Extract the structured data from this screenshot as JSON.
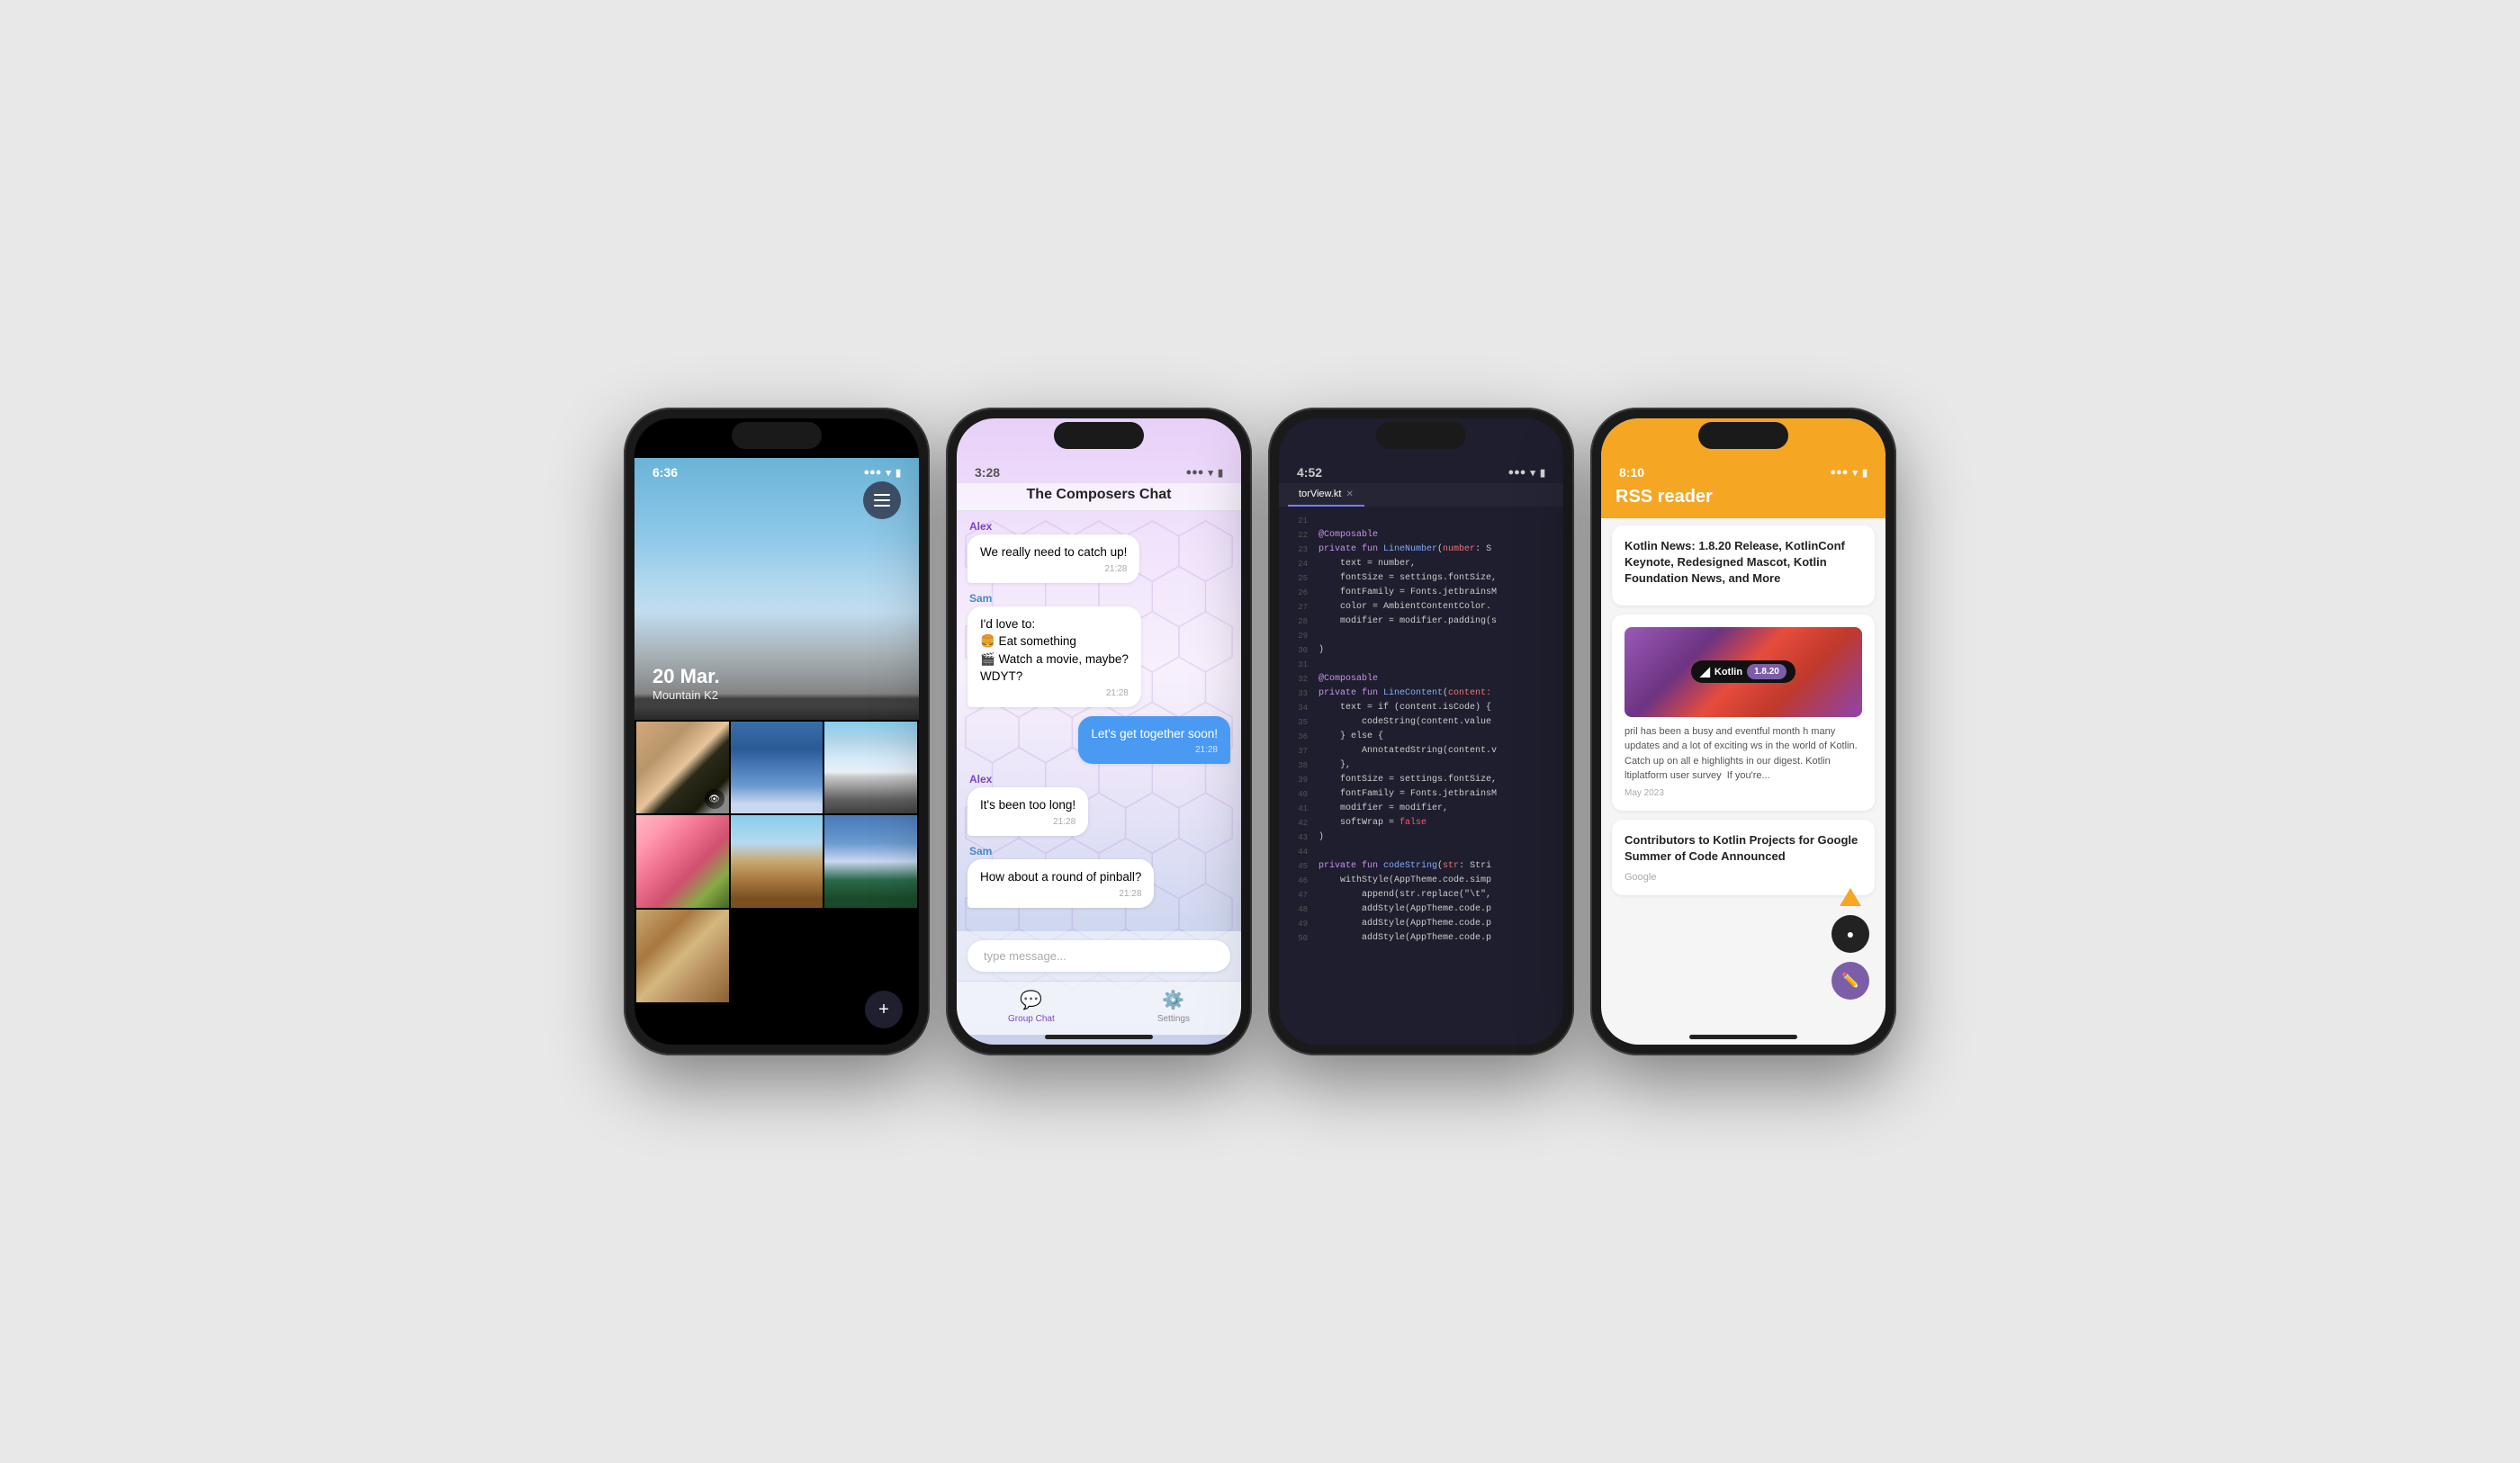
{
  "phones": [
    {
      "id": "gallery",
      "time": "6:36",
      "hero": {
        "date": "20 Mar.",
        "location": "Mountain K2"
      },
      "grid_images": [
        "cat",
        "blue-city",
        "mountain2",
        "cherry",
        "desert",
        "tower",
        "last"
      ],
      "add_btn_label": "+"
    },
    {
      "id": "chat",
      "time": "3:28",
      "title": "The Composers Chat",
      "messages": [
        {
          "sender": "Alex",
          "text": "We really need to catch up!",
          "time": "21:28",
          "type": "received",
          "sender_class": "alex"
        },
        {
          "sender": "Sam",
          "text": "I'd love to:\n🍔 Eat something\n🎬 Watch a movie, maybe?\nWDYT?",
          "time": "21:28",
          "type": "received",
          "sender_class": "sam"
        },
        {
          "sender": "",
          "text": "Let's get together soon!",
          "time": "21:28",
          "type": "sent",
          "sender_class": ""
        },
        {
          "sender": "Alex",
          "text": "It's been too long!",
          "time": "21:28",
          "type": "received",
          "sender_class": "alex"
        },
        {
          "sender": "Sam",
          "text": "How about a round of pinball?",
          "time": "21:28",
          "type": "received",
          "sender_class": "sam"
        }
      ],
      "input_placeholder": "type message...",
      "tabs": [
        {
          "label": "Group Chat",
          "icon": "💬",
          "active": true
        },
        {
          "label": "Settings",
          "icon": "⚙️",
          "active": false
        }
      ]
    },
    {
      "id": "code",
      "time": "4:52",
      "tab_name": "torView.kt",
      "lines": [
        {
          "num": "21",
          "code": ""
        },
        {
          "num": "22",
          "tokens": [
            [
              "kw",
              "@Composable"
            ]
          ]
        },
        {
          "num": "23",
          "tokens": [
            [
              "kw",
              "private fun "
            ],
            [
              "fn",
              "LineNumber"
            ],
            [
              "",
              "("
            ],
            [
              "param",
              "number"
            ],
            [
              "",
              ": S"
            ]
          ]
        },
        {
          "num": "24",
          "tokens": [
            [
              "",
              "    text = number,"
            ]
          ]
        },
        {
          "num": "25",
          "tokens": [
            [
              "",
              "    fontSize = settings.fontSize,"
            ]
          ]
        },
        {
          "num": "26",
          "tokens": [
            [
              "",
              "    fontFamily = Fonts.jetbrainsM"
            ]
          ]
        },
        {
          "num": "27",
          "tokens": [
            [
              "",
              "    color = AmbientContentColor."
            ]
          ]
        },
        {
          "num": "28",
          "tokens": [
            [
              "",
              "    modifier = modifier.padding(s"
            ]
          ]
        },
        {
          "num": "29",
          "tokens": [
            [
              "",
              ""
            ]
          ]
        },
        {
          "num": "30",
          "tokens": [
            [
              "",
              ")"
            ]
          ]
        },
        {
          "num": "31",
          "tokens": [
            [
              "",
              ""
            ]
          ]
        },
        {
          "num": "32",
          "tokens": [
            [
              "kw",
              "@Composable"
            ]
          ]
        },
        {
          "num": "33",
          "tokens": [
            [
              "kw",
              "private fun "
            ],
            [
              "fn",
              "LineContent"
            ],
            [
              "",
              "("
            ],
            [
              "param",
              "content:"
            ]
          ]
        },
        {
          "num": "34",
          "tokens": [
            [
              "",
              "    text = if (content.isCode) {"
            ]
          ]
        },
        {
          "num": "35",
          "tokens": [
            [
              "",
              "        codeString(content.value"
            ]
          ]
        },
        {
          "num": "36",
          "tokens": [
            [
              "",
              "    } else {"
            ]
          ]
        },
        {
          "num": "37",
          "tokens": [
            [
              "",
              "        AnnotatedString(content.v"
            ]
          ]
        },
        {
          "num": "38",
          "tokens": [
            [
              "",
              "    },"
            ]
          ]
        },
        {
          "num": "39",
          "tokens": [
            [
              "",
              "    fontSize = settings.fontSize,"
            ]
          ]
        },
        {
          "num": "40",
          "tokens": [
            [
              "",
              "    fontFamily = Fonts.jetbrainsM"
            ]
          ]
        },
        {
          "num": "41",
          "tokens": [
            [
              "",
              "    modifier = modifier,"
            ]
          ]
        },
        {
          "num": "42",
          "tokens": [
            [
              "",
              "    softWrap = "
            ],
            [
              "bool",
              "false"
            ]
          ]
        },
        {
          "num": "43",
          "tokens": [
            [
              "",
              ")"
            ]
          ]
        },
        {
          "num": "44",
          "tokens": [
            [
              "",
              ""
            ]
          ]
        },
        {
          "num": "45",
          "tokens": [
            [
              "kw",
              "private fun "
            ],
            [
              "fn",
              "codeString"
            ],
            [
              "",
              "("
            ],
            [
              "param",
              "str"
            ],
            [
              "",
              ": Stri"
            ]
          ]
        },
        {
          "num": "46",
          "tokens": [
            [
              "",
              "    withStyle(AppTheme.code.simp"
            ]
          ]
        },
        {
          "num": "47",
          "tokens": [
            [
              "",
              "        append(str.replace(\"\\t\","
            ]
          ]
        },
        {
          "num": "48",
          "tokens": [
            [
              "",
              "        addStyle(AppTheme.code.p"
            ]
          ]
        },
        {
          "num": "49",
          "tokens": [
            [
              "",
              "        addStyle(AppTheme.code.p"
            ]
          ]
        },
        {
          "num": "50",
          "tokens": [
            [
              "",
              "        addStyle(AppTheme.code.p"
            ]
          ]
        }
      ]
    },
    {
      "id": "rss",
      "time": "8:10",
      "header_title": "RSS reader",
      "card1": {
        "title": "Kotlin News: 1.8.20 Release, KotlinConf Keynote, Redesigned Mascot, Kotlin Foundation News, and More",
        "kotlin_label": "Kotlin",
        "version_label": "1.8.20"
      },
      "card2": {
        "body": "pril has been a busy and eventful month h many updates and a lot of exciting ws in the world of Kotlin. Catch up on all e highlights in our digest. Kotlin ltiplatform user survey  If you're...",
        "date": "May 2023"
      },
      "card3": {
        "title": "Contributors to Kotlin Projects for Google Summer of Code Announced",
        "footer": "Google"
      }
    }
  ]
}
